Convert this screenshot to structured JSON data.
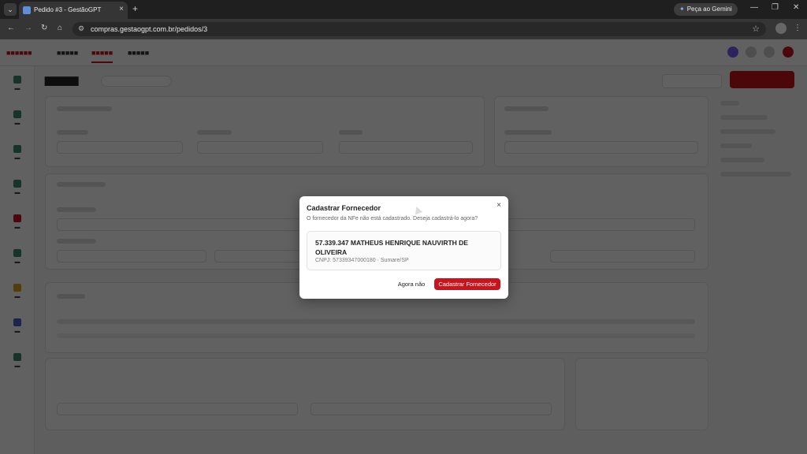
{
  "browser": {
    "tab_title": "Pedido #3 - GestãoGPT",
    "gemini_label": "Peça ao Gemini",
    "url": "compras.gestaogpt.com.br/pedidos/3"
  },
  "modal": {
    "title": "Cadastrar Fornecedor",
    "close": "×",
    "message": "O fornecedor da NFe não está cadastrado. Deseja cadastrá-lo agora?",
    "supplier_name": "57.339.347 MATHEUS HENRIQUE NAUVIRTH DE OLIVEIRA",
    "supplier_details": "CNPJ: 57339347000180 · Sumare/SP",
    "later_button": "Agora não",
    "confirm_button": "Cadastrar Fornecedor"
  }
}
